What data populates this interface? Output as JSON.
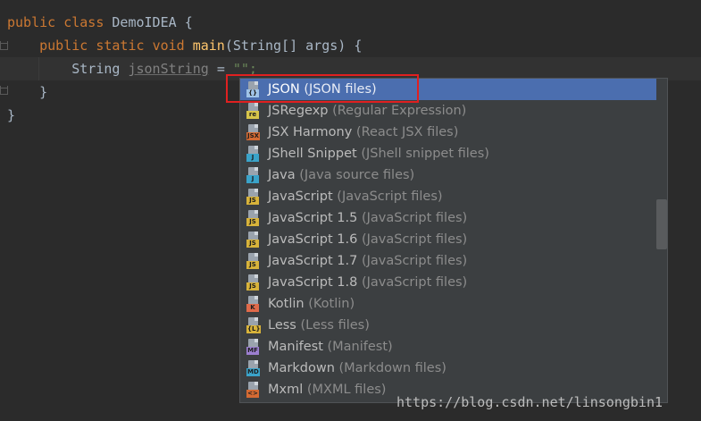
{
  "code": {
    "line1": {
      "kw1": "public",
      "kw2": "class",
      "name": "DemoIDEA",
      "brace": "{"
    },
    "line2": {
      "kw1": "public",
      "kw2": "static",
      "kw3": "void",
      "fn": "main",
      "args": "(String[] args)",
      "brace": "{"
    },
    "line3": {
      "type": "String",
      "var": "jsonString",
      "eq": "=",
      "str": "\"\";"
    },
    "line4": "}",
    "line5": "}"
  },
  "completion": {
    "items": [
      {
        "name": "JSON",
        "desc": "(JSON files)",
        "icon": "json-file-icon",
        "tag": "{}",
        "tag_color": "#a0c4e8",
        "selected": true
      },
      {
        "name": "JSRegexp",
        "desc": "(Regular Expression)",
        "icon": "regexp-file-icon",
        "tag": "re",
        "tag_color": "#d7c54a"
      },
      {
        "name": "JSX Harmony",
        "desc": "(React JSX files)",
        "icon": "jsx-file-icon",
        "tag": "JSX",
        "tag_color": "#d46a33"
      },
      {
        "name": "JShell Snippet",
        "desc": "(JShell snippet files)",
        "icon": "jshell-file-icon",
        "tag": "J",
        "tag_color": "#3aa3c9"
      },
      {
        "name": "Java",
        "desc": "(Java source files)",
        "icon": "java-file-icon",
        "tag": "J",
        "tag_color": "#3aa3c9"
      },
      {
        "name": "JavaScript",
        "desc": "(JavaScript files)",
        "icon": "javascript-file-icon",
        "tag": "JS",
        "tag_color": "#d8b33a"
      },
      {
        "name": "JavaScript 1.5",
        "desc": "(JavaScript files)",
        "icon": "javascript-file-icon",
        "tag": "JS",
        "tag_color": "#d8b33a"
      },
      {
        "name": "JavaScript 1.6",
        "desc": "(JavaScript files)",
        "icon": "javascript-file-icon",
        "tag": "JS",
        "tag_color": "#d8b33a"
      },
      {
        "name": "JavaScript 1.7",
        "desc": "(JavaScript files)",
        "icon": "javascript-file-icon",
        "tag": "JS",
        "tag_color": "#d8b33a"
      },
      {
        "name": "JavaScript 1.8",
        "desc": "(JavaScript files)",
        "icon": "javascript-file-icon",
        "tag": "JS",
        "tag_color": "#d8b33a"
      },
      {
        "name": "Kotlin",
        "desc": "(Kotlin)",
        "icon": "kotlin-file-icon",
        "tag": "K",
        "tag_color": "#e06a4a"
      },
      {
        "name": "Less",
        "desc": "(Less files)",
        "icon": "less-file-icon",
        "tag": "{L}",
        "tag_color": "#d8b33a"
      },
      {
        "name": "Manifest",
        "desc": "(Manifest)",
        "icon": "manifest-file-icon",
        "tag": "MF",
        "tag_color": "#9c7fd0"
      },
      {
        "name": "Markdown",
        "desc": "(Markdown files)",
        "icon": "markdown-file-icon",
        "tag": "MD",
        "tag_color": "#3aa3c9"
      },
      {
        "name": "Mxml",
        "desc": "(MXML files)",
        "icon": "mxml-file-icon",
        "tag": "<>",
        "tag_color": "#d46a33"
      }
    ]
  },
  "watermark": "https://blog.csdn.net/linsongbin1"
}
